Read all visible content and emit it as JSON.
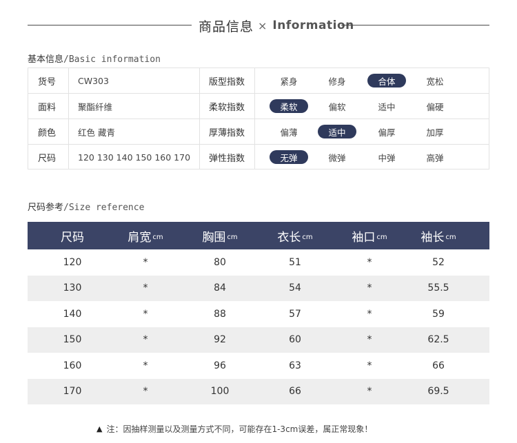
{
  "header": {
    "title_zh": "商品信息",
    "separator": "×",
    "title_en": "Information"
  },
  "basic_section": {
    "title_zh": "基本信息",
    "title_en": "/Basic information"
  },
  "basic_rows": [
    {
      "label": "货号",
      "value": "CW303",
      "attr": "版型指数",
      "options": [
        "紧身",
        "修身",
        "合体",
        "宽松"
      ],
      "selected": 2
    },
    {
      "label": "面料",
      "value": "聚酯纤维",
      "attr": "柔软指数",
      "options": [
        "柔软",
        "偏软",
        "适中",
        "偏硬"
      ],
      "selected": 0
    },
    {
      "label": "颜色",
      "value": "红色 藏青",
      "attr": "厚薄指数",
      "options": [
        "偏薄",
        "适中",
        "偏厚",
        "加厚"
      ],
      "selected": 1
    },
    {
      "label": "尺码",
      "value": "120 130 140 150 160 170",
      "attr": "弹性指数",
      "options": [
        "无弹",
        "微弹",
        "中弹",
        "高弹"
      ],
      "selected": 0
    }
  ],
  "size_section": {
    "title_zh": "尺码参考",
    "title_en": "/Size reference"
  },
  "size_table": {
    "headers": [
      {
        "label": "尺码",
        "unit": ""
      },
      {
        "label": "肩宽",
        "unit": "cm"
      },
      {
        "label": "胸围",
        "unit": "cm"
      },
      {
        "label": "衣长",
        "unit": "cm"
      },
      {
        "label": "袖口",
        "unit": "cm"
      },
      {
        "label": "袖长",
        "unit": "cm"
      }
    ],
    "rows": [
      [
        "120",
        "*",
        "80",
        "51",
        "*",
        "52"
      ],
      [
        "130",
        "*",
        "84",
        "54",
        "*",
        "55.5"
      ],
      [
        "140",
        "*",
        "88",
        "57",
        "*",
        "59"
      ],
      [
        "150",
        "*",
        "92",
        "60",
        "*",
        "62.5"
      ],
      [
        "160",
        "*",
        "96",
        "63",
        "*",
        "66"
      ],
      [
        "170",
        "*",
        "100",
        "66",
        "*",
        "69.5"
      ]
    ]
  },
  "note": {
    "icon": "warning-triangle-icon",
    "text": "注：因抽样测量以及测量方式不同，可能存在1-3cm误差，属正常现象！"
  },
  "colors": {
    "header_bg": "#3b4466",
    "selected_pill": "#2f3a5c",
    "alt_row": "#eeeeee"
  }
}
